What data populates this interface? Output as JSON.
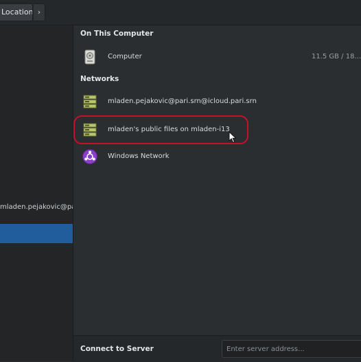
{
  "toolbar": {
    "breadcrumb_label": "Locations",
    "next_glyph": "›"
  },
  "sidebar": {
    "items": [
      {
        "label": "mladen.pejakovic@pari.srn@icloud.p..."
      },
      {
        "label": ""
      }
    ]
  },
  "main": {
    "on_this_computer": {
      "heading": "On This Computer",
      "items": [
        {
          "label": "Computer",
          "meta": "11.5 GB / 18..."
        }
      ]
    },
    "networks": {
      "heading": "Networks",
      "items": [
        {
          "label": "mladen.pejakovic@pari.srn@icloud.pari.srn",
          "icon": "network-server-icon"
        },
        {
          "label": "mladen's public files on mladen-i13",
          "icon": "network-server-icon"
        },
        {
          "label": "Windows Network",
          "icon": "windows-network-icon"
        }
      ]
    }
  },
  "footer": {
    "label": "Connect to Server",
    "placeholder": "Enter server address..."
  },
  "colors": {
    "selection": "#215d9c",
    "highlight_ring": "#c8102e"
  }
}
